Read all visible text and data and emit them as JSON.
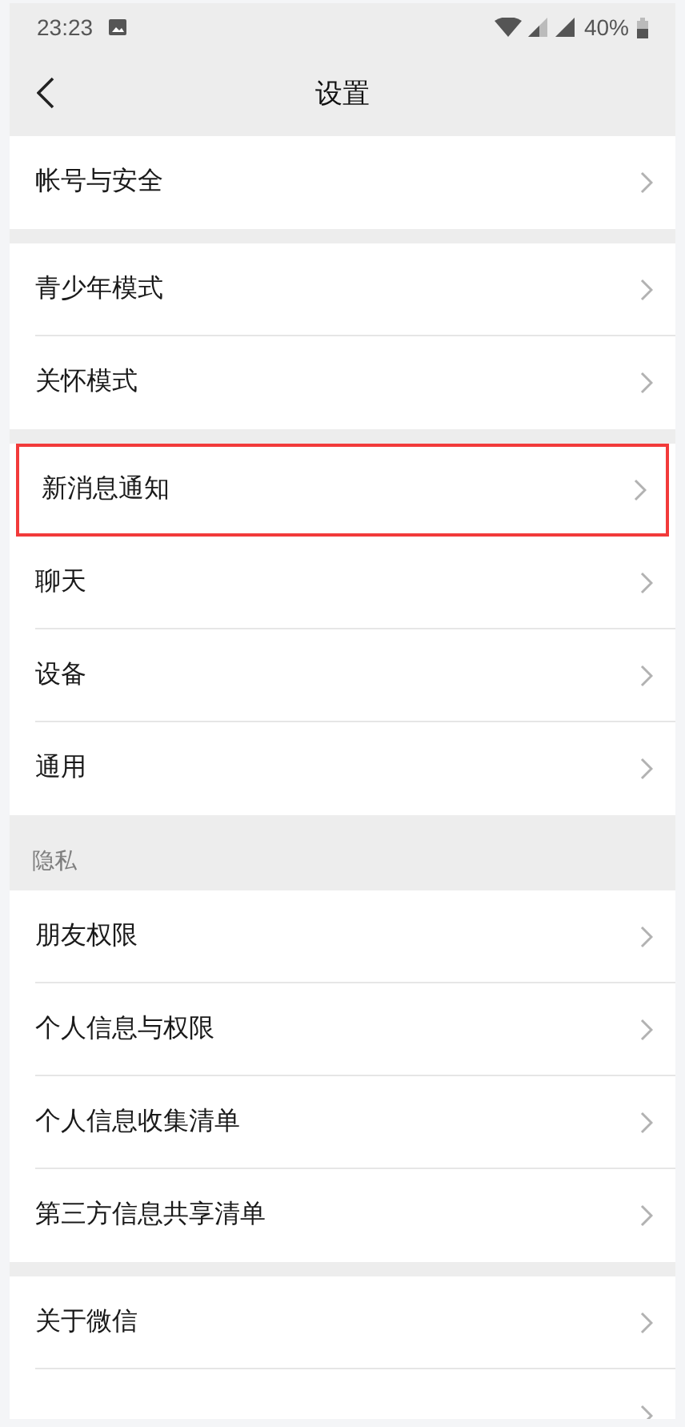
{
  "status_bar": {
    "time": "23:23",
    "battery": "40%"
  },
  "header": {
    "title": "设置"
  },
  "sections": [
    {
      "items": [
        {
          "label": "帐号与安全",
          "highlighted": false
        }
      ]
    },
    {
      "items": [
        {
          "label": "青少年模式",
          "highlighted": false
        },
        {
          "label": "关怀模式",
          "highlighted": false
        }
      ]
    },
    {
      "items": [
        {
          "label": "新消息通知",
          "highlighted": true
        },
        {
          "label": "聊天",
          "highlighted": false
        },
        {
          "label": "设备",
          "highlighted": false
        },
        {
          "label": "通用",
          "highlighted": false
        }
      ]
    },
    {
      "header": "隐私",
      "items": [
        {
          "label": "朋友权限",
          "highlighted": false
        },
        {
          "label": "个人信息与权限",
          "highlighted": false
        },
        {
          "label": "个人信息收集清单",
          "highlighted": false
        },
        {
          "label": "第三方信息共享清单",
          "highlighted": false
        }
      ]
    },
    {
      "items": [
        {
          "label": "关于微信",
          "highlighted": false
        },
        {
          "highlighted": false
        }
      ]
    }
  ]
}
